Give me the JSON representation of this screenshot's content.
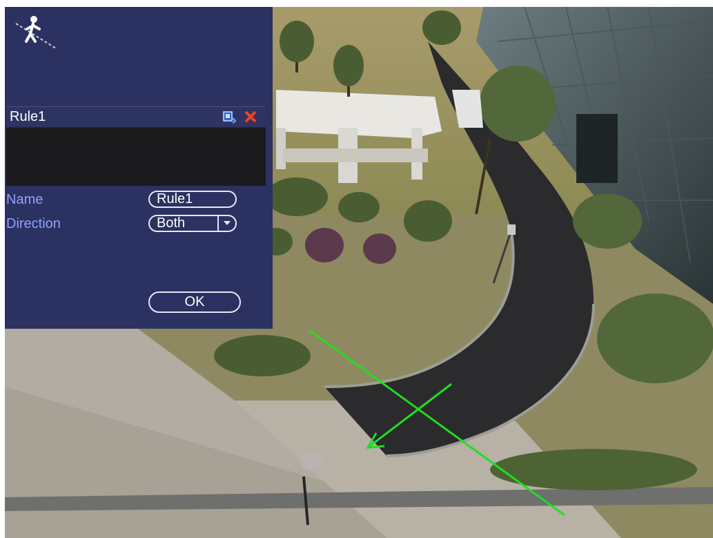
{
  "panel": {
    "icon": "tripwire-pedestrian-icon",
    "rules": [
      {
        "name": "Rule1",
        "edit_icon": "edit-rule-icon",
        "delete_icon": "delete-rule-icon"
      }
    ],
    "name_label": "Name",
    "name_value": "Rule1",
    "direction_label": "Direction",
    "direction_value": "Both",
    "ok_label": "OK"
  },
  "overlay": {
    "tripwire_color": "#22dd22"
  }
}
